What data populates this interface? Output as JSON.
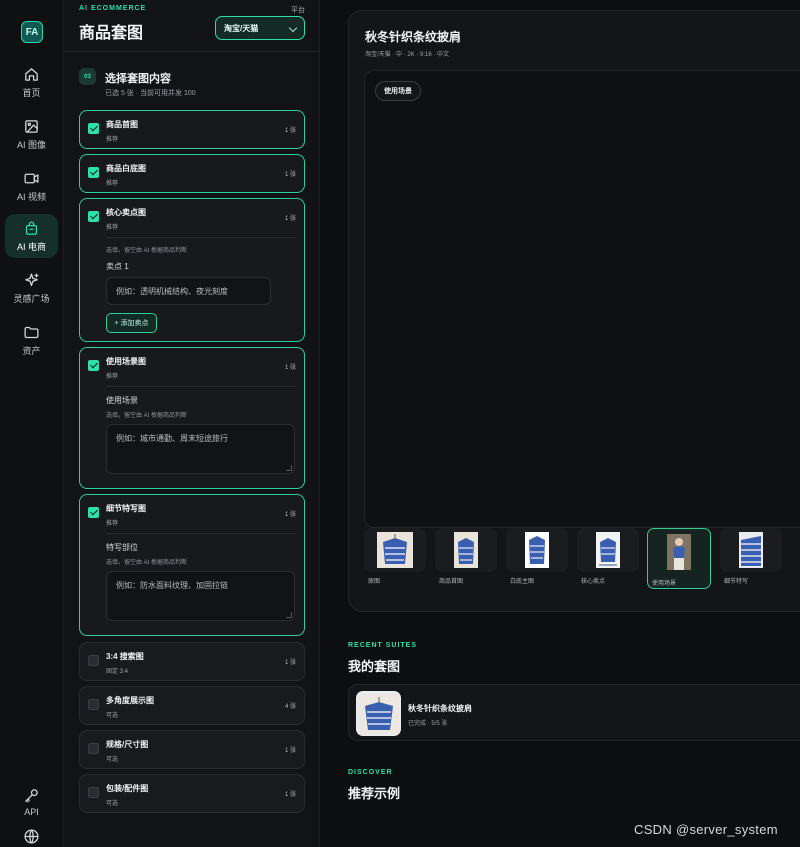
{
  "nav": {
    "logo_text": "FA",
    "items": [
      {
        "label": "首页",
        "icon": "home-icon"
      },
      {
        "label": "AI 图像",
        "icon": "image-icon"
      },
      {
        "label": "AI 视频",
        "icon": "video-icon"
      },
      {
        "label": "AI 电商",
        "icon": "shopping-bag-icon",
        "active": true
      },
      {
        "label": "灵感广场",
        "icon": "sparkle-icon"
      },
      {
        "label": "资产",
        "icon": "folder-icon"
      }
    ],
    "api_label": "API"
  },
  "panel": {
    "eyebrow": "AI ECOMMERCE",
    "title": "商品套图",
    "platform_label": "平台",
    "platform_value": "淘宝/天猫",
    "step": {
      "number": "03",
      "title": "选择套图内容",
      "subtitle": "已选 5 张 · 当前可用并发 100"
    },
    "options": [
      {
        "name": "商品首图",
        "tag": "推荐",
        "count": "1 张",
        "selected": true
      },
      {
        "name": "商品白底图",
        "tag": "推荐",
        "count": "1 张",
        "selected": true
      },
      {
        "name": "核心卖点图",
        "tag": "推荐",
        "count": "1 张",
        "selected": true,
        "hint": "选填，留空由 AI 根据商品判断",
        "field_label": "卖点 1",
        "placeholder": "例如：透明机械结构、夜光刻度",
        "add_label": "+ 添加卖点"
      },
      {
        "name": "使用场景图",
        "tag": "推荐",
        "count": "1 张",
        "selected": true,
        "field_label": "使用场景",
        "hint": "选填，留空由 AI 根据商品判断",
        "placeholder": "例如：城市通勤、周末短途旅行"
      },
      {
        "name": "细节特写图",
        "tag": "推荐",
        "count": "1 张",
        "selected": true,
        "field_label": "特写部位",
        "hint": "选填，留空由 AI 根据商品判断",
        "placeholder": "例如：防水面料纹理、加固拉链"
      },
      {
        "name": "3:4 搜索图",
        "tag": "固定 3:4",
        "count": "1 张",
        "selected": false
      },
      {
        "name": "多角度展示图",
        "tag": "可选",
        "count": "4 张",
        "selected": false
      },
      {
        "name": "规格/尺寸图",
        "tag": "可选",
        "count": "1 张",
        "selected": false
      },
      {
        "name": "包装/配件图",
        "tag": "可选",
        "count": "1 张",
        "selected": false
      }
    ]
  },
  "preview": {
    "title": "秋冬针织条纹披肩",
    "meta": "淘宝/天猫 · 中 · 2K · 9:16 · 中文",
    "active_chip": "使用场景",
    "thumbs": [
      {
        "caption": "原图"
      },
      {
        "caption": "商品首图"
      },
      {
        "caption": "白底主图"
      },
      {
        "caption": "核心卖点"
      },
      {
        "caption": "使用场景",
        "active": true
      },
      {
        "caption": "细节特写"
      }
    ],
    "colors": {
      "accent": "#2ee0a8",
      "product_blue": "#3b5fb0"
    }
  },
  "recent": {
    "eyebrow": "RECENT SUITES",
    "title": "我的套图",
    "card_name": "秋冬针织条纹披肩",
    "card_status": "已完成 · 5/5 张"
  },
  "discover": {
    "eyebrow": "DISCOVER",
    "title": "推荐示例"
  },
  "watermark": "CSDN @server_system"
}
